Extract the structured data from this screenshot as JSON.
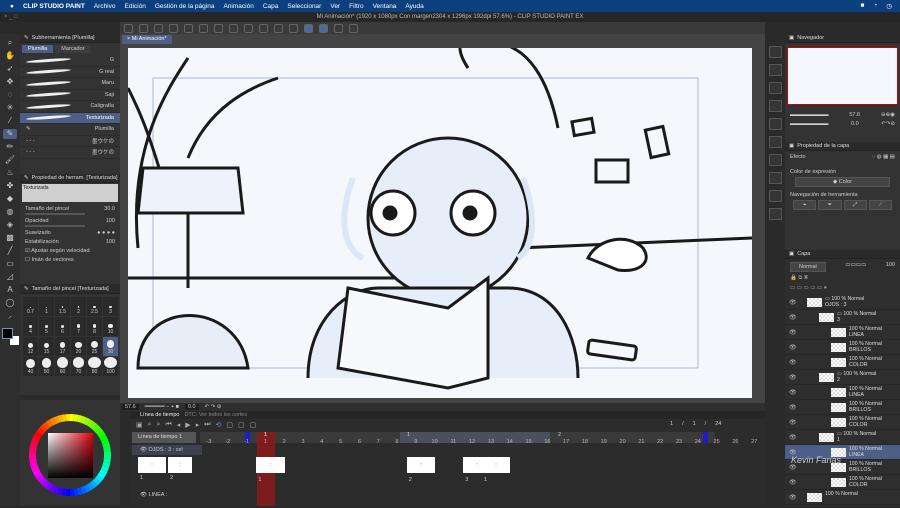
{
  "menubar": {
    "app": "CLIP STUDIO PAINT",
    "items": [
      "Archivo",
      "Edición",
      "Gestión de la página",
      "Animación",
      "Capa",
      "Seleccionar",
      "Ver",
      "Filtro",
      "Ventana",
      "Ayuda"
    ]
  },
  "title": "Mi Animación* (1920 x 1080px Con margen2304 x 1296px 192dpi 57.6%)  - CLIP STUDIO PAINT EX",
  "canvas_tab": "× Mi Animación*",
  "subtool": {
    "header": "Subherramienta [Plumilla]",
    "tabs": [
      "Plumilla",
      "Marcador"
    ],
    "brushes": [
      "G",
      "G real",
      "Maru",
      "Saji",
      "Caligrafía",
      "Texturizada",
      "Plumilla",
      "墨ウケの",
      "墨ウケの"
    ],
    "selected": "Texturizada"
  },
  "toolprop": {
    "header": "Propiedad de herram. [Texturizada]",
    "preview_label": "Texturizada",
    "brush_size_label": "Tamaño del pincel",
    "brush_size": "30.0",
    "opacity_label": "Opacidad",
    "opacity": "100",
    "smoothing_label": "Suavizado",
    "stabilization_label": "Estabilización",
    "stabilization": "100",
    "velocity_label": "Ajustar según velocidad",
    "vector_label": "Imán de vectores"
  },
  "brush_sizes": {
    "header": "Tamaño del pincel [Texturizada]",
    "values": [
      "0.7",
      "1",
      "1.5",
      "2",
      "2.5",
      "3",
      "4",
      "5",
      "6",
      "7",
      "8",
      "10",
      "12",
      "15",
      "17",
      "20",
      "25",
      "30",
      "40",
      "50",
      "60",
      "70",
      "80",
      "100"
    ],
    "selected": "30"
  },
  "status": {
    "zoom": "57.6",
    "angle": "0.0"
  },
  "timeline": {
    "tab": "Línea de tiempo",
    "tab2": "DTC: Ver todos los cortes",
    "name": "Línea de tiempo 1",
    "layer1": "OJOS : 3 : cel",
    "layer2": "LINEA :",
    "frames": [
      "-3",
      "-2",
      "-1",
      "1",
      "2",
      "3",
      "4",
      "5",
      "6",
      "7",
      "8",
      "9",
      "10",
      "11",
      "12",
      "13",
      "14",
      "15",
      "16",
      "17",
      "18",
      "19",
      "20",
      "21",
      "22",
      "23",
      "24",
      "25",
      "26",
      "27"
    ],
    "markers": [
      "1",
      "1",
      "2",
      "3"
    ],
    "counter": [
      "1",
      "/",
      "1",
      "/",
      "24"
    ],
    "cels": [
      {
        "frame": "1",
        "label": "1"
      },
      {
        "frame": "9",
        "label": "2"
      },
      {
        "frame": "12",
        "label": "3"
      },
      {
        "frame": "13",
        "label": "1"
      }
    ],
    "cel_list": [
      "1",
      "2"
    ]
  },
  "navigator": {
    "title": "Navegador",
    "zoom": "57.6",
    "rotate": "0.0"
  },
  "layer_property": {
    "title": "Propiedad de la capa",
    "effect": "Efecto",
    "expression_color": "Color de expresión",
    "color_value": "Color",
    "tool_nav": "Navegación de herramienta"
  },
  "layers": {
    "tab": "Capa",
    "blend": "Normal",
    "opacity": "100",
    "rows": [
      {
        "top": "100 % Normal",
        "name": "OJOS : 3",
        "indent": 0,
        "folder": true
      },
      {
        "top": "100 % Normal",
        "name": "3",
        "indent": 1,
        "folder": true
      },
      {
        "top": "100 % Normal",
        "name": "LINEA",
        "indent": 2
      },
      {
        "top": "100 % Normal",
        "name": "BRILLOS",
        "indent": 2
      },
      {
        "top": "100 % Normal",
        "name": "COLOR",
        "indent": 2
      },
      {
        "top": "100 % Normal",
        "name": "2",
        "indent": 1,
        "folder": true
      },
      {
        "top": "100 % Normal",
        "name": "LINEA",
        "indent": 2
      },
      {
        "top": "100 % Normal",
        "name": "BRILLOS",
        "indent": 2
      },
      {
        "top": "100 % Normal",
        "name": "COLOR",
        "indent": 2
      },
      {
        "top": "100 % Normal",
        "name": "1",
        "indent": 1,
        "folder": true
      },
      {
        "top": "100 % Normal",
        "name": "LINEA",
        "indent": 2,
        "selected": true
      },
      {
        "top": "100 % Normal",
        "name": "BRILLOS",
        "indent": 2
      },
      {
        "top": "100 % Normal",
        "name": "COLOR",
        "indent": 2
      },
      {
        "top": "100 % Normal",
        "name": "",
        "indent": 0
      }
    ]
  },
  "watermark": "Kevin Farias",
  "colors": {
    "menubar": "#0b3f7e",
    "selection": "#4d5f86",
    "playhead": "#8b1a1a"
  }
}
